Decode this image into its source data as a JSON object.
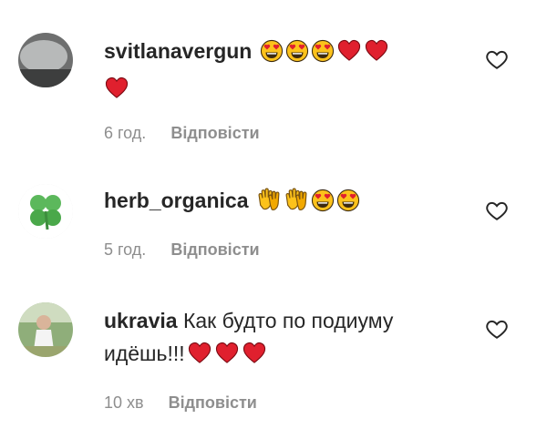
{
  "comments": [
    {
      "username": "svitlanavergun",
      "text": "",
      "emojis": [
        "heart-eyes",
        "heart-eyes",
        "heart-eyes",
        "red-heart",
        "red-heart",
        "red-heart"
      ],
      "time": "6 год.",
      "reply_label": "Відповісти",
      "avatar": "avatar-photo-grey"
    },
    {
      "username": "herb_organica",
      "text": "",
      "emojis": [
        "clapping-hands",
        "clapping-hands",
        "heart-eyes",
        "heart-eyes"
      ],
      "time": "5 год.",
      "reply_label": "Відповісти",
      "avatar": "four-leaf-clover"
    },
    {
      "username": "ukravia",
      "text": "Как будто по подиуму идёшь!!!",
      "emojis": [
        "red-heart",
        "red-heart",
        "red-heart"
      ],
      "time": "10 хв",
      "reply_label": "Відповісти",
      "avatar": "avatar-photo-outdoor"
    }
  ],
  "colors": {
    "text": "#262626",
    "secondary": "#8e8e8e",
    "heart": "#e0202e",
    "emoji_face": "#fcc21b",
    "clover": "#5cb85c"
  }
}
